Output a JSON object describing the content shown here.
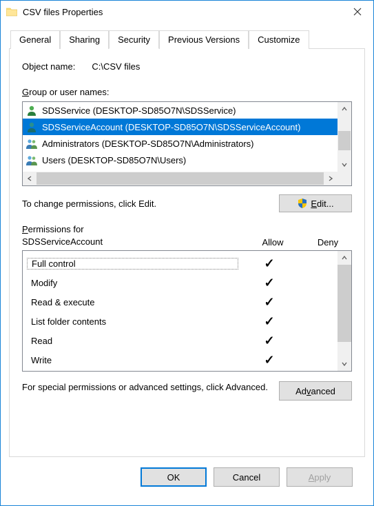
{
  "title": "CSV files Properties",
  "tabs": [
    {
      "label": "General"
    },
    {
      "label": "Sharing"
    },
    {
      "label": "Security"
    },
    {
      "label": "Previous Versions"
    },
    {
      "label": "Customize"
    }
  ],
  "object_name_label": "Object name:",
  "object_name_value": "C:\\CSV files",
  "groups_label_pre": "G",
  "groups_label_post": "roup or user names:",
  "users": [
    {
      "name": "SDSService (DESKTOP-SD85O7N\\SDSService)",
      "type": "single"
    },
    {
      "name": "SDSServiceAccount (DESKTOP-SD85O7N\\SDSServiceAccount)",
      "type": "single",
      "selected": true
    },
    {
      "name": "Administrators (DESKTOP-SD85O7N\\Administrators)",
      "type": "group"
    },
    {
      "name": "Users (DESKTOP-SD85O7N\\Users)",
      "type": "group"
    }
  ],
  "hint_text": "To change permissions, click Edit.",
  "edit_button_pre": "E",
  "edit_button_post": "dit...",
  "perm_header_pre": "P",
  "perm_header_mid": "ermissions for",
  "perm_header_user": "SDSServiceAccount",
  "allow_label": "Allow",
  "deny_label": "Deny",
  "permissions": [
    {
      "name": "Full control",
      "allow": true,
      "deny": false
    },
    {
      "name": "Modify",
      "allow": true,
      "deny": false
    },
    {
      "name": "Read & execute",
      "allow": true,
      "deny": false
    },
    {
      "name": "List folder contents",
      "allow": true,
      "deny": false
    },
    {
      "name": "Read",
      "allow": true,
      "deny": false
    },
    {
      "name": "Write",
      "allow": true,
      "deny": false
    }
  ],
  "advanced_hint": "For special permissions or advanced settings, click Advanced.",
  "advanced_button_pre": "Ad",
  "advanced_button_u": "v",
  "advanced_button_post": "anced",
  "ok_label": "OK",
  "cancel_label": "Cancel",
  "apply_label_pre": "A",
  "apply_label_post": "pply",
  "check_mark": "✓"
}
